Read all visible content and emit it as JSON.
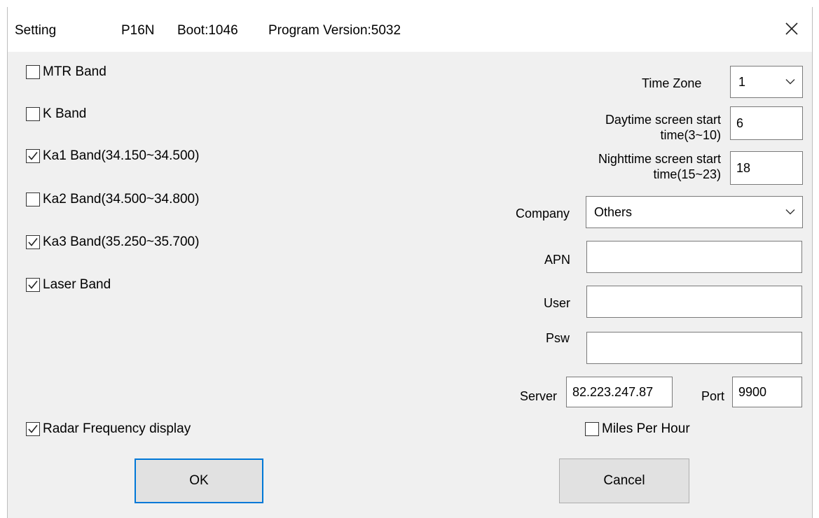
{
  "titlebar": {
    "title": "Setting",
    "model": "P16N",
    "boot": "Boot:1046",
    "version": "Program Version:5032"
  },
  "bands": [
    {
      "label": "MTR Band",
      "checked": false
    },
    {
      "label": "K Band",
      "checked": false
    },
    {
      "label": "Ka1 Band(34.150~34.500)",
      "checked": true
    },
    {
      "label": "Ka2 Band(34.500~34.800)",
      "checked": false
    },
    {
      "label": "Ka3 Band(35.250~35.700)",
      "checked": true
    },
    {
      "label": "Laser Band",
      "checked": true
    }
  ],
  "radar_freq": {
    "label": "Radar Frequency display",
    "checked": true
  },
  "miles": {
    "label": "Miles Per Hour",
    "checked": false
  },
  "timezone": {
    "label": "Time Zone",
    "value": "1"
  },
  "daytime": {
    "label_line1": "Daytime screen start",
    "label_line2": "time(3~10)",
    "value": "6"
  },
  "nighttime": {
    "label_line1": "Nighttime screen start",
    "label_line2": "time(15~23)",
    "value": "18"
  },
  "company": {
    "label": "Company",
    "value": "Others"
  },
  "apn": {
    "label": "APN",
    "value": ""
  },
  "user": {
    "label": "User",
    "value": ""
  },
  "psw": {
    "label": "Psw",
    "value": ""
  },
  "server": {
    "label": "Server",
    "value": "82.223.247.87"
  },
  "port": {
    "label": "Port",
    "value": "9900"
  },
  "buttons": {
    "ok": "OK",
    "cancel": "Cancel"
  }
}
